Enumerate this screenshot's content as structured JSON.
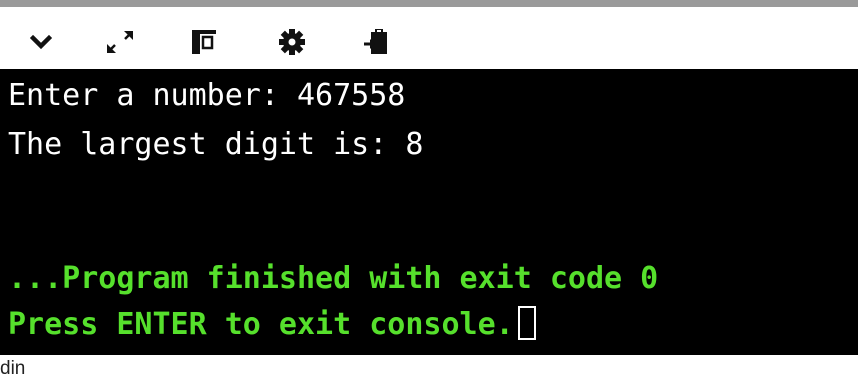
{
  "toolbar": {
    "buttons": [
      {
        "name": "collapse",
        "icon": "chevron-down-icon"
      },
      {
        "name": "expand",
        "icon": "expand-arrows-icon"
      },
      {
        "name": "layout",
        "icon": "panel-layout-icon"
      },
      {
        "name": "settings",
        "icon": "gear-icon"
      },
      {
        "name": "copy-output",
        "icon": "clipboard-paste-icon"
      }
    ],
    "icon_color": "#111111"
  },
  "console": {
    "background": "#000000",
    "output_color": "#ffffff",
    "status_color": "#56e02c",
    "lines": [
      "Enter a number: 467558",
      "The largest digit is: 8",
      "",
      "...Program finished with exit code 0",
      "Press ENTER to exit console."
    ]
  },
  "footer": {
    "label": "din"
  }
}
